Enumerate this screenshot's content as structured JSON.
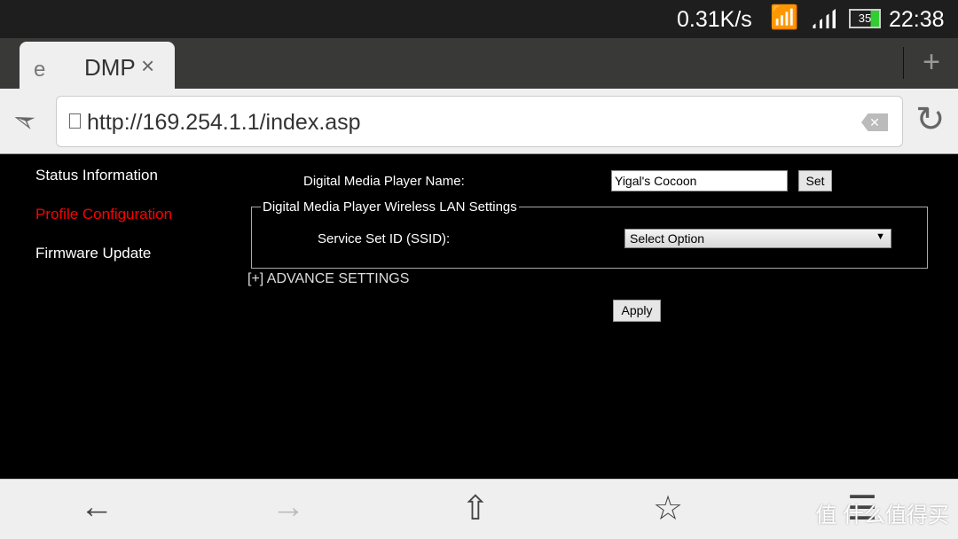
{
  "status_bar": {
    "speed": "0.31K/s",
    "battery": "35",
    "time": "22:38"
  },
  "tabs": [
    {
      "label": "e"
    },
    {
      "label": "DMP",
      "close": "×"
    }
  ],
  "new_tab": "+",
  "address_bar": {
    "url": "http://169.254.1.1/index.asp"
  },
  "sidebar": {
    "items": [
      {
        "label": "Status Information",
        "color": "#ffffff"
      },
      {
        "label": "Profile Configuration",
        "color": "#ff0000",
        "active": true
      },
      {
        "label": "Firmware Update",
        "color": "#ffffff"
      }
    ]
  },
  "form": {
    "name_label": "Digital Media Player Name:",
    "name_value": "Yigal's Cocoon",
    "set_label": "Set",
    "wlan_legend": "Digital Media Player Wireless LAN Settings",
    "ssid_label": "Service Set ID (SSID):",
    "ssid_value": "Select Option",
    "advance_label": "[+] ADVANCE SETTINGS",
    "apply_label": "Apply"
  },
  "watermark": "值 什么值得买"
}
